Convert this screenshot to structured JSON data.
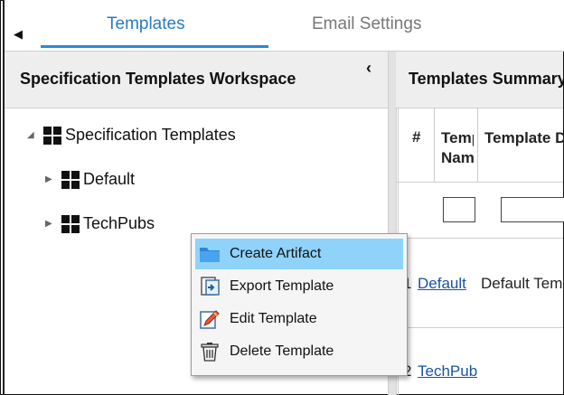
{
  "tabs": {
    "scroll_arrow": "◀",
    "items": [
      {
        "label": "Templates",
        "active": true
      },
      {
        "label": "Email Settings",
        "active": false
      }
    ]
  },
  "left_panel": {
    "title": "Specification Templates Workspace",
    "collapse_glyph": "‹",
    "tree": {
      "root": {
        "label": "Specification Templates",
        "expanded": true,
        "icon": "grid-icon"
      },
      "children": [
        {
          "label": "Default",
          "expanded": false,
          "icon": "grid-icon"
        },
        {
          "label": "TechPubs",
          "expanded": false,
          "icon": "grid-icon"
        }
      ]
    }
  },
  "right_panel": {
    "title": "Templates Summary",
    "columns": {
      "number": "#",
      "name": "Template Name",
      "description": "Template Description"
    },
    "rows": [
      {
        "num": "1",
        "name": "Default",
        "description": "Default Template"
      },
      {
        "num": "2",
        "name": "TechPubs",
        "description": ""
      }
    ]
  },
  "context_menu": {
    "items": [
      {
        "label": "Create Artifact",
        "icon": "folder-icon",
        "highlighted": true
      },
      {
        "label": "Export Template",
        "icon": "export-icon",
        "highlighted": false
      },
      {
        "label": "Edit Template",
        "icon": "edit-icon",
        "highlighted": false
      },
      {
        "label": "Delete Template",
        "icon": "trash-icon",
        "highlighted": false
      }
    ]
  },
  "colors": {
    "accent": "#2b88d8",
    "link": "#1a52a8",
    "menu_highlight": "#8fd3fb",
    "panel_header": "#eeeeee"
  }
}
